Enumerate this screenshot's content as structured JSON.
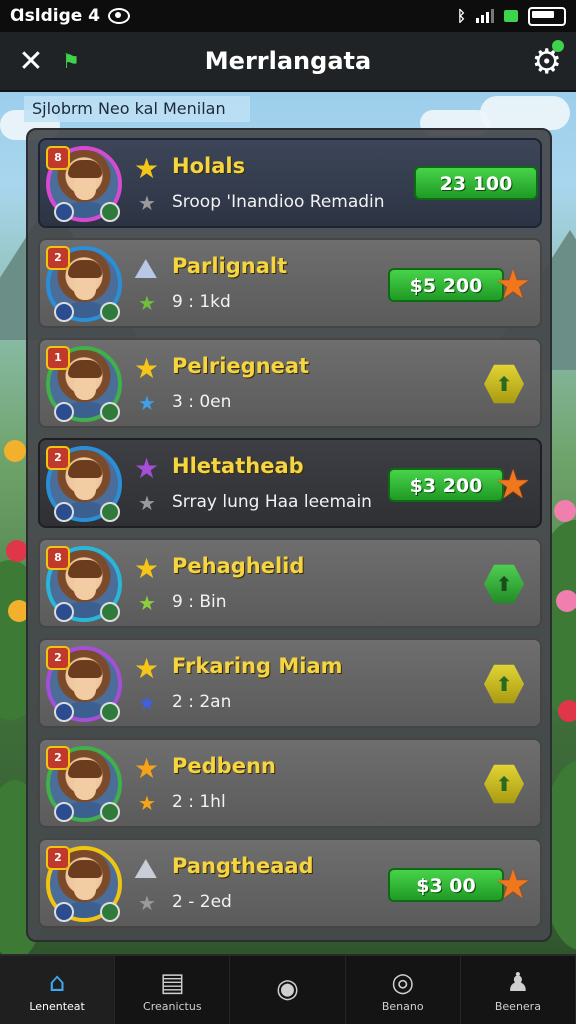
{
  "status_bar": {
    "time": "Ɑsldige 4",
    "icons": [
      "eye-icon",
      "bluetooth-icon",
      "signal-icon",
      "wifi-icon",
      "battery-icon"
    ]
  },
  "top_bar": {
    "title": "Merrlangata",
    "close_icon": "✕",
    "flag_icon": "⚑",
    "gear_icon": "⚙"
  },
  "subheader": "Sjlobrm Neo kal Menilan",
  "rows": [
    {
      "rank": "8",
      "name": "Holals",
      "subtext": "Sroop 'Inandioo Remadin",
      "price": "23 100",
      "action": "price",
      "star": "★",
      "star_color": "#f5c518",
      "sub_icon": "★",
      "sub_icon_color": "#9a9a9a",
      "style": "dark",
      "ring": "#d64ad2"
    },
    {
      "rank": "2",
      "name": "Parlignalt",
      "subtext": "9 : 1kd",
      "price": "$5 200",
      "action": "price-star",
      "star": "⛰",
      "star_color": "#b8c7e6",
      "sub_icon": "★",
      "sub_icon_color": "#6dbf3c",
      "style": "normal",
      "ring": "#2a8fd6"
    },
    {
      "rank": "1",
      "name": "Pelriegneat",
      "subtext": "3 : 0en",
      "price": "",
      "action": "hex-yellow",
      "star": "★",
      "star_color": "#f5c518",
      "sub_icon": "★",
      "sub_icon_color": "#3fa0e6",
      "style": "normal",
      "ring": "#3fb04a"
    },
    {
      "rank": "2",
      "name": "Hletatheab",
      "subtext": "Srray lung Haa leemain",
      "price": "$3 200",
      "action": "price-star",
      "star": "★",
      "star_color": "#a44fd6",
      "sub_icon": "★",
      "sub_icon_color": "#9a9a9a",
      "style": "darker",
      "ring": "#2a8fd6"
    },
    {
      "rank": "8",
      "name": "Pehaghelid",
      "subtext": "9 : Bin",
      "price": "",
      "action": "hex-green",
      "star": "★",
      "star_color": "#f5c518",
      "sub_icon": "★",
      "sub_icon_color": "#8ccf3c",
      "style": "normal",
      "ring": "#2ab6d6"
    },
    {
      "rank": "2",
      "name": "Frkaring Miam",
      "subtext": "2 : 2an",
      "price": "",
      "action": "hex-yellow",
      "star": "★",
      "star_color": "#f5c518",
      "sub_icon": "★",
      "sub_icon_color": "#3f5fe6",
      "style": "normal",
      "ring": "#a44fd6"
    },
    {
      "rank": "2",
      "name": "Pedbenn",
      "subtext": "2 : 1hl",
      "price": "",
      "action": "hex-yellow",
      "star": "★",
      "star_color": "#f5a418",
      "sub_icon": "★",
      "sub_icon_color": "#f5a418",
      "style": "normal",
      "ring": "#3fb04a"
    },
    {
      "rank": "2",
      "name": "Pangtheaad",
      "subtext": "2 - 2ed",
      "price": "$3 00",
      "action": "price-star",
      "star": "⛰",
      "star_color": "#c9cdd8",
      "sub_icon": "★",
      "sub_icon_color": "#9a9a9a",
      "style": "normal",
      "ring": "#f1c40f"
    }
  ],
  "nav": [
    {
      "label": "Lenenteat",
      "icon": "home-icon",
      "glyph": "⌂",
      "active": true
    },
    {
      "label": "Creanictus",
      "icon": "document-icon",
      "glyph": "▤",
      "active": false
    },
    {
      "label": "",
      "icon": "play-icon",
      "glyph": "◉",
      "active": false
    },
    {
      "label": "Benano",
      "icon": "camera-icon",
      "glyph": "◎",
      "active": false
    },
    {
      "label": "Beenera",
      "icon": "person-icon",
      "glyph": "♟",
      "active": false
    }
  ]
}
